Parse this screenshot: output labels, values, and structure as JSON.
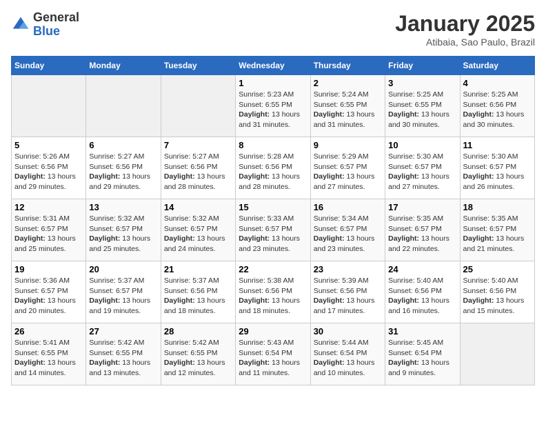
{
  "header": {
    "logo_line1": "General",
    "logo_line2": "Blue",
    "month": "January 2025",
    "location": "Atibaia, Sao Paulo, Brazil"
  },
  "days_of_week": [
    "Sunday",
    "Monday",
    "Tuesday",
    "Wednesday",
    "Thursday",
    "Friday",
    "Saturday"
  ],
  "weeks": [
    [
      {
        "day": "",
        "text": ""
      },
      {
        "day": "",
        "text": ""
      },
      {
        "day": "",
        "text": ""
      },
      {
        "day": "1",
        "text": "Sunrise: 5:23 AM\nSunset: 6:55 PM\nDaylight: 13 hours and 31 minutes."
      },
      {
        "day": "2",
        "text": "Sunrise: 5:24 AM\nSunset: 6:55 PM\nDaylight: 13 hours and 31 minutes."
      },
      {
        "day": "3",
        "text": "Sunrise: 5:25 AM\nSunset: 6:55 PM\nDaylight: 13 hours and 30 minutes."
      },
      {
        "day": "4",
        "text": "Sunrise: 5:25 AM\nSunset: 6:56 PM\nDaylight: 13 hours and 30 minutes."
      }
    ],
    [
      {
        "day": "5",
        "text": "Sunrise: 5:26 AM\nSunset: 6:56 PM\nDaylight: 13 hours and 29 minutes."
      },
      {
        "day": "6",
        "text": "Sunrise: 5:27 AM\nSunset: 6:56 PM\nDaylight: 13 hours and 29 minutes."
      },
      {
        "day": "7",
        "text": "Sunrise: 5:27 AM\nSunset: 6:56 PM\nDaylight: 13 hours and 28 minutes."
      },
      {
        "day": "8",
        "text": "Sunrise: 5:28 AM\nSunset: 6:56 PM\nDaylight: 13 hours and 28 minutes."
      },
      {
        "day": "9",
        "text": "Sunrise: 5:29 AM\nSunset: 6:57 PM\nDaylight: 13 hours and 27 minutes."
      },
      {
        "day": "10",
        "text": "Sunrise: 5:30 AM\nSunset: 6:57 PM\nDaylight: 13 hours and 27 minutes."
      },
      {
        "day": "11",
        "text": "Sunrise: 5:30 AM\nSunset: 6:57 PM\nDaylight: 13 hours and 26 minutes."
      }
    ],
    [
      {
        "day": "12",
        "text": "Sunrise: 5:31 AM\nSunset: 6:57 PM\nDaylight: 13 hours and 25 minutes."
      },
      {
        "day": "13",
        "text": "Sunrise: 5:32 AM\nSunset: 6:57 PM\nDaylight: 13 hours and 25 minutes."
      },
      {
        "day": "14",
        "text": "Sunrise: 5:32 AM\nSunset: 6:57 PM\nDaylight: 13 hours and 24 minutes."
      },
      {
        "day": "15",
        "text": "Sunrise: 5:33 AM\nSunset: 6:57 PM\nDaylight: 13 hours and 23 minutes."
      },
      {
        "day": "16",
        "text": "Sunrise: 5:34 AM\nSunset: 6:57 PM\nDaylight: 13 hours and 23 minutes."
      },
      {
        "day": "17",
        "text": "Sunrise: 5:35 AM\nSunset: 6:57 PM\nDaylight: 13 hours and 22 minutes."
      },
      {
        "day": "18",
        "text": "Sunrise: 5:35 AM\nSunset: 6:57 PM\nDaylight: 13 hours and 21 minutes."
      }
    ],
    [
      {
        "day": "19",
        "text": "Sunrise: 5:36 AM\nSunset: 6:57 PM\nDaylight: 13 hours and 20 minutes."
      },
      {
        "day": "20",
        "text": "Sunrise: 5:37 AM\nSunset: 6:57 PM\nDaylight: 13 hours and 19 minutes."
      },
      {
        "day": "21",
        "text": "Sunrise: 5:37 AM\nSunset: 6:56 PM\nDaylight: 13 hours and 18 minutes."
      },
      {
        "day": "22",
        "text": "Sunrise: 5:38 AM\nSunset: 6:56 PM\nDaylight: 13 hours and 18 minutes."
      },
      {
        "day": "23",
        "text": "Sunrise: 5:39 AM\nSunset: 6:56 PM\nDaylight: 13 hours and 17 minutes."
      },
      {
        "day": "24",
        "text": "Sunrise: 5:40 AM\nSunset: 6:56 PM\nDaylight: 13 hours and 16 minutes."
      },
      {
        "day": "25",
        "text": "Sunrise: 5:40 AM\nSunset: 6:56 PM\nDaylight: 13 hours and 15 minutes."
      }
    ],
    [
      {
        "day": "26",
        "text": "Sunrise: 5:41 AM\nSunset: 6:55 PM\nDaylight: 13 hours and 14 minutes."
      },
      {
        "day": "27",
        "text": "Sunrise: 5:42 AM\nSunset: 6:55 PM\nDaylight: 13 hours and 13 minutes."
      },
      {
        "day": "28",
        "text": "Sunrise: 5:42 AM\nSunset: 6:55 PM\nDaylight: 13 hours and 12 minutes."
      },
      {
        "day": "29",
        "text": "Sunrise: 5:43 AM\nSunset: 6:54 PM\nDaylight: 13 hours and 11 minutes."
      },
      {
        "day": "30",
        "text": "Sunrise: 5:44 AM\nSunset: 6:54 PM\nDaylight: 13 hours and 10 minutes."
      },
      {
        "day": "31",
        "text": "Sunrise: 5:45 AM\nSunset: 6:54 PM\nDaylight: 13 hours and 9 minutes."
      },
      {
        "day": "",
        "text": ""
      }
    ]
  ]
}
